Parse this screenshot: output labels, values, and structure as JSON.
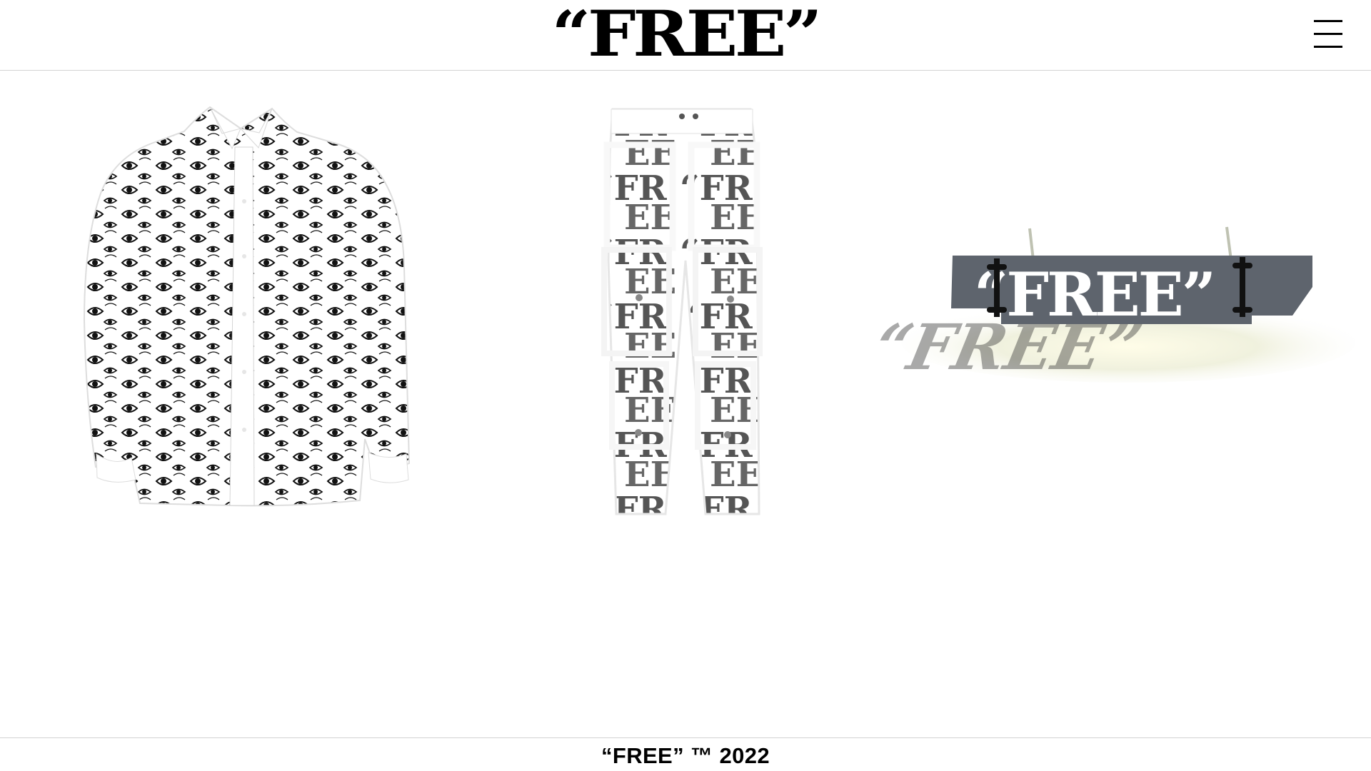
{
  "brand": {
    "logo_text": "“FREE”"
  },
  "header": {
    "menu_icon": "hamburger-menu-icon"
  },
  "products": [
    {
      "name": "eye-print-shirt",
      "icon": "shirt-image"
    },
    {
      "name": "logo-print-cargo-pants",
      "icon": "pants-image"
    },
    {
      "name": "free-metal-sign",
      "icon": "sign-image",
      "sign_text": "“FREE”"
    }
  ],
  "footer": {
    "copyright": "“FREE” ™ 2022"
  },
  "colors": {
    "background": "#ffffff",
    "text": "#000000",
    "border": "#d3d3d3",
    "metal": "#5e646d"
  }
}
